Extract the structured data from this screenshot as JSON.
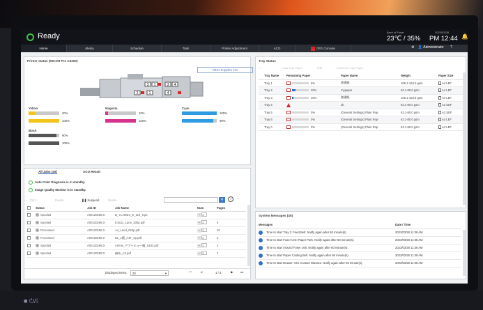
{
  "header": {
    "status": "Ready",
    "fuser_label": "Back of Fuser",
    "temp_humidity": "23℃ / 35%",
    "date": "2023/03/28",
    "time": "PM 12:44"
  },
  "nav": {
    "tabs": [
      "Home",
      "Media",
      "Schedule",
      "Task",
      "Printer Adjustment",
      "ACO",
      "DFE Console"
    ],
    "user": "Administrator"
  },
  "printer_status": {
    "title": "Printer status (RICOH Pro C5300)",
    "other_supplies_label": "Other Supplies Info",
    "unit_labels": [
      "3",
      "1",
      "3",
      "4",
      "2",
      "1",
      "4"
    ],
    "supplies": [
      {
        "name": "Yellow",
        "level": 20,
        "label": "20%",
        "color": "#f2c318"
      },
      {
        "name": "",
        "level": 100,
        "label": "100%",
        "color": "#f2c318"
      },
      {
        "name": "Magenta",
        "level": 10,
        "label": "10%",
        "color": "#d6318f"
      },
      {
        "name": "",
        "level": 100,
        "label": "100%",
        "color": "#d6318f"
      },
      {
        "name": "Cyan",
        "level": 100,
        "label": "100%",
        "color": "#2f9be0"
      },
      {
        "name": "",
        "level": 90,
        "label": "90%",
        "color": "#2f9be0"
      },
      {
        "name": "Black",
        "level": 90,
        "label": "90%",
        "color": "#555555"
      },
      {
        "name": "",
        "level": 100,
        "label": "100%",
        "color": "#555555"
      }
    ]
  },
  "tray_status": {
    "title": "Tray Status",
    "tools": [
      "+",
      "Load Tray Paper",
      "Edit",
      "Extend to Tray Paper"
    ],
    "columns": [
      "Tray Name",
      "Remaining Paper",
      "Paper Name",
      "Weight",
      "Paper Size"
    ],
    "rows": [
      {
        "name": "Tray 1",
        "remaining": 0,
        "pct": "0%",
        "paper": "普通紙",
        "weight": "105.1-163.0 gsm",
        "size": "A4 LEF",
        "warn": false
      },
      {
        "name": "Tray 2",
        "remaining": 20,
        "pct": "20%",
        "paper": "mypaper",
        "weight": "63.1-80.0 gsm",
        "size": "A4 LEF",
        "warn": false
      },
      {
        "name": "Tray 3",
        "remaining": 10,
        "pct": "10%",
        "paper": "普通紙",
        "weight": "105.1-163.0 gsm",
        "size": "A4 LEF",
        "warn": false
      },
      {
        "name": "Tray 4",
        "remaining": 0,
        "pct": "",
        "paper": "ok",
        "weight": "63.1-80.0 gsm",
        "size": "A3 SEF",
        "warn": true
      },
      {
        "name": "Tray 5",
        "remaining": 0,
        "pct": "0%",
        "paper": "(General Settings) Plain Pap·",
        "weight": "63.1-80.0 gsm",
        "size": "A3 SEF",
        "warn": false
      },
      {
        "name": "Tray 6",
        "remaining": 0,
        "pct": "0%",
        "paper": "(General Settings) Plain Pap·",
        "weight": "63.1-80.0 gsm",
        "size": "A4 LEF",
        "warn": false
      },
      {
        "name": "Tray A",
        "remaining": 0,
        "pct": "0%",
        "paper": "(General Settings) Plain Pap·",
        "weight": "63.1-80.0 gsm",
        "size": "A4 LEF",
        "warn": false
      }
    ]
  },
  "jobs": {
    "tabs": [
      "All Jobs (20)",
      "ACO Result"
    ],
    "status_lines": [
      "Auto Color Diagnosis is in standby.",
      "Image Quality Monitor is in standby."
    ],
    "tools": [
      "Print",
      "Delete",
      "Suspend",
      "Delete"
    ],
    "columns": [
      "Status",
      "Job ID",
      "Job Name",
      "Num",
      "Pages"
    ],
    "rows": [
      {
        "status": "Spooled",
        "id": "A00120296.0·",
        "name": "B_YLAMEX_E_110_9.ps",
        "num": "1",
        "pages": ""
      },
      {
        "status": "Spooled",
        "id": "A00120296.0·",
        "name": "8.5x11_Lane_300p.pdf",
        "num": "1",
        "pages": "5"
      },
      {
        "status": "Processed",
        "id": "A00120296.0·",
        "name": "A4_Land_020p.pdf",
        "num": "1",
        "pages": "20"
      },
      {
        "status": "Processed",
        "id": "A00120296.0·",
        "name": "B1_1横_A3T_2p.pdf",
        "num": "1",
        "pages": "2"
      },
      {
        "status": "Spooled",
        "id": "A00120296.0·",
        "name": "Anmix_アプイキュー備_S103.pdf",
        "num": "1",
        "pages": "2"
      },
      {
        "status": "Spooled",
        "id": "A00120296.0·",
        "name": "麻布_A3.pdf",
        "num": "1",
        "pages": "2"
      }
    ],
    "footer": {
      "display_label": "Displayed Items",
      "display_value": "20",
      "page": "1 / 3"
    }
  },
  "messages": {
    "title": "System Messages (45)",
    "columns": [
      "Messages",
      "Date / Time"
    ],
    "rows": [
      {
        "text": "Time to start Tray 2: Feed Belt. Notify again after 60 minute(s).",
        "time": "2023/03/28 11:38 AM"
      },
      {
        "text": "Time to start Fuser Unit: Paper Path. Notify again after 60 minute(s).",
        "time": "2023/03/28 11:38 AM"
      },
      {
        "text": "Time to start Around Fuser Unit. Notify again after 60 minute(s).",
        "time": "2023/03/28 11:38 AM"
      },
      {
        "text": "Time to start Paper Cooling Belt. Notify again after 60 minute(s).",
        "time": "2023/03/28 11:38 AM"
      },
      {
        "text": "Time to start Drawer: CIS Contact Glasses. Notify again after 60 minute(s).",
        "time": "2023/03/28 11:38 AM"
      }
    ]
  },
  "colors": {
    "accent": "#2f6fc4",
    "ready": "#3fc24c",
    "warn": "#d62828"
  }
}
